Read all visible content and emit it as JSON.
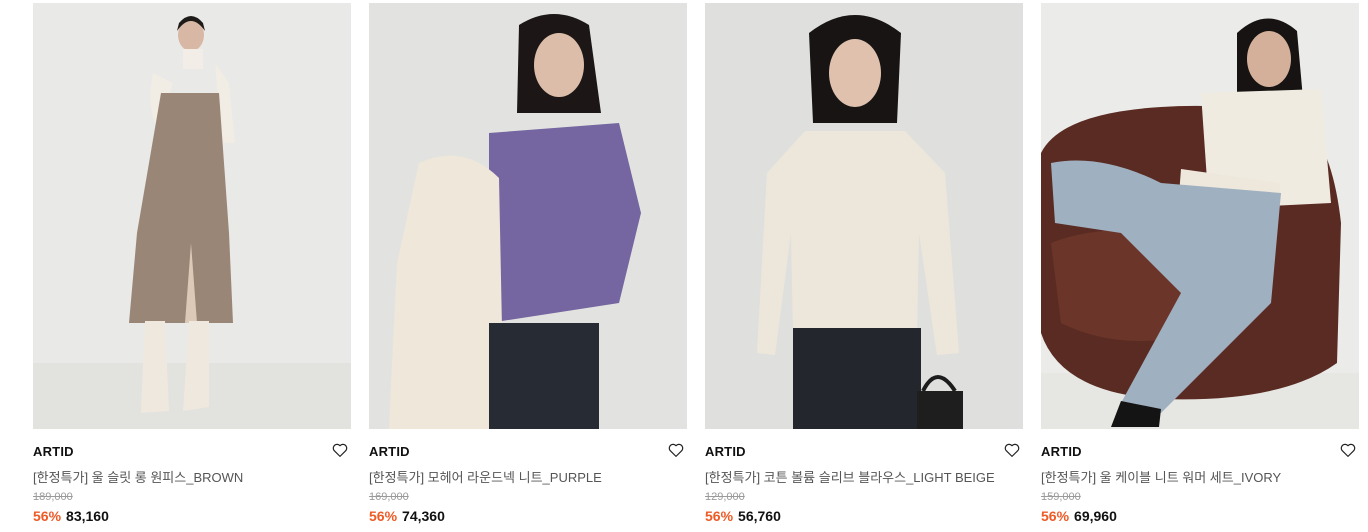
{
  "products": [
    {
      "brand": "ARTID",
      "name": "[한정특가] 울 슬릿 롱 원피스_BROWN",
      "original_price": "189,000",
      "discount": "56%",
      "sale_price": "83,160",
      "wishlist_icon": "heart-outline-icon",
      "colors": {
        "bg": "#e9e9e7",
        "garment": "#9a8677"
      }
    },
    {
      "brand": "ARTID",
      "name": "[한정특가] 모헤어 라운드넥 니트_PURPLE",
      "original_price": "169,000",
      "discount": "56%",
      "sale_price": "74,360",
      "wishlist_icon": "heart-outline-icon",
      "colors": {
        "bg": "#e2e3e0",
        "garment": "#7565a0"
      }
    },
    {
      "brand": "ARTID",
      "name": "[한정특가] 코튼 볼륨 슬리브 블라우스_LIGHT BEIGE",
      "original_price": "129,000",
      "discount": "56%",
      "sale_price": "56,760",
      "wishlist_icon": "heart-outline-icon",
      "colors": {
        "bg": "#dfe0dd",
        "garment": "#ece7da"
      }
    },
    {
      "brand": "ARTID",
      "name": "[한정특가] 울 케이블 니트 워머 세트_IVORY",
      "original_price": "159,000",
      "discount": "56%",
      "sale_price": "69,960",
      "wishlist_icon": "heart-outline-icon",
      "colors": {
        "bg": "#ebebe9",
        "garment": "#f0ebe0"
      }
    }
  ],
  "accent_color": "#ef5a25"
}
